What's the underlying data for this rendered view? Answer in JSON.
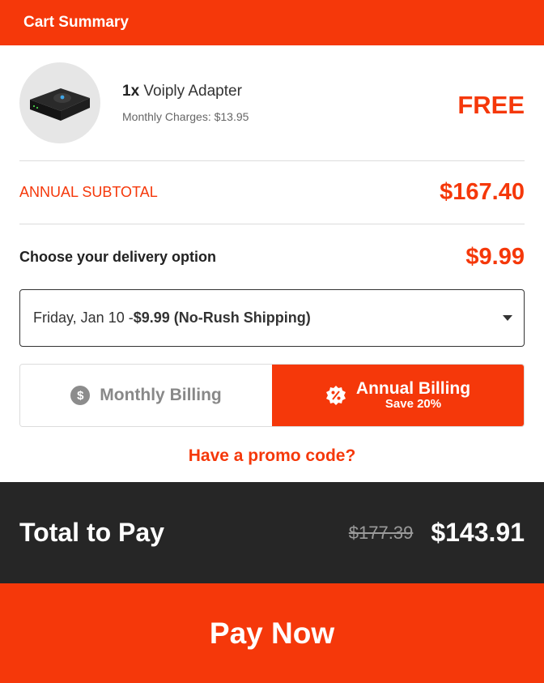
{
  "header": {
    "title": "Cart Summary"
  },
  "product": {
    "quantity": "1x",
    "name": "Voiply Adapter",
    "monthly_charges": "Monthly Charges: $13.95",
    "price": "FREE",
    "image_icon": "adapter-device-icon"
  },
  "subtotal": {
    "label": "ANNUAL SUBTOTAL",
    "value": "$167.40"
  },
  "delivery": {
    "label": "Choose your delivery option",
    "value": "$9.99",
    "selected_prefix": "Friday, Jan 10 -",
    "selected_bold": "$9.99 (No-Rush Shipping)"
  },
  "billing": {
    "monthly_label": "Monthly Billing",
    "monthly_icon": "dollar-coin-icon",
    "annual_label": "Annual Billing",
    "annual_sub": "Save 20%",
    "annual_icon": "discount-badge-icon",
    "selected": "annual"
  },
  "promo": {
    "label": "Have a promo code?"
  },
  "total": {
    "label": "Total to Pay",
    "original": "$177.39",
    "final": "$143.91"
  },
  "pay_button": {
    "label": "Pay Now"
  },
  "colors": {
    "accent": "#f5380a",
    "dark": "#262626",
    "muted": "#8c8c8c"
  }
}
